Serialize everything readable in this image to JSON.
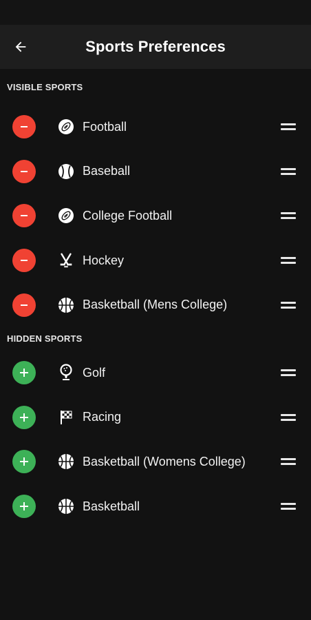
{
  "header": {
    "title": "Sports Preferences"
  },
  "visible_section": {
    "title": "VISIBLE SPORTS",
    "items": [
      {
        "label": "Football",
        "icon": "football-icon"
      },
      {
        "label": "Baseball",
        "icon": "baseball-icon"
      },
      {
        "label": "College Football",
        "icon": "football-icon"
      },
      {
        "label": "Hockey",
        "icon": "hockey-icon"
      },
      {
        "label": "Basketball (Mens College)",
        "icon": "basketball-icon"
      }
    ]
  },
  "hidden_section": {
    "title": "HIDDEN SPORTS",
    "items": [
      {
        "label": "Golf",
        "icon": "golf-icon"
      },
      {
        "label": "Racing",
        "icon": "racing-flag-icon"
      },
      {
        "label": "Basketball (Womens College)",
        "icon": "basketball-icon"
      },
      {
        "label": "Basketball",
        "icon": "basketball-icon"
      }
    ]
  },
  "colors": {
    "remove": "#f04233",
    "add": "#3db157",
    "background": "#121212",
    "app_bar": "#1e1e1e"
  }
}
